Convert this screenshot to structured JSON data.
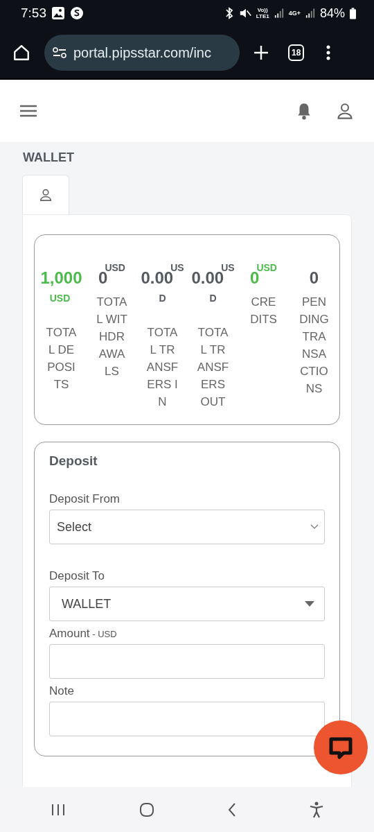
{
  "status_bar": {
    "time": "7:53",
    "network_1": [
      "Vo))",
      "LTE1"
    ],
    "network_2": "4G+",
    "battery": "84%"
  },
  "browser": {
    "url": "portal.pipsstar.com/inc",
    "tab_count": "18"
  },
  "page": {
    "title": "WALLET",
    "tabs": [
      {
        "selected": true
      }
    ],
    "stats": [
      {
        "value": "1,000",
        "unit": "USD",
        "label": "TOTAL DEPOSITS",
        "color": "#4cbb4c"
      },
      {
        "value": "0",
        "unit": "USD",
        "label": "TOTAL WITHDRAWALS",
        "color": "#555a60"
      },
      {
        "value": "0.00",
        "unit": "USD",
        "label": "TOTAL TRANSFERS IN",
        "color": "#555a60"
      },
      {
        "value": "0.00",
        "unit": "USD",
        "label": "TOTAL TRANSFERS OUT",
        "color": "#555a60"
      },
      {
        "value": "0",
        "unit": "USD",
        "label": "CREDITS",
        "color": "#4cbb4c"
      },
      {
        "value": "0",
        "label": "PENDING TRANSACTIONS",
        "color": "#555a60"
      }
    ],
    "deposit": {
      "title": "Deposit",
      "fields": [
        {
          "kind": "select",
          "label": "Deposit From",
          "value": "Select"
        },
        {
          "kind": "dropdown",
          "label": "Deposit To",
          "value": "WALLET"
        },
        {
          "kind": "input",
          "label": "Amount",
          "suffix": "- USD"
        },
        {
          "kind": "input",
          "label": "Note"
        }
      ]
    }
  }
}
